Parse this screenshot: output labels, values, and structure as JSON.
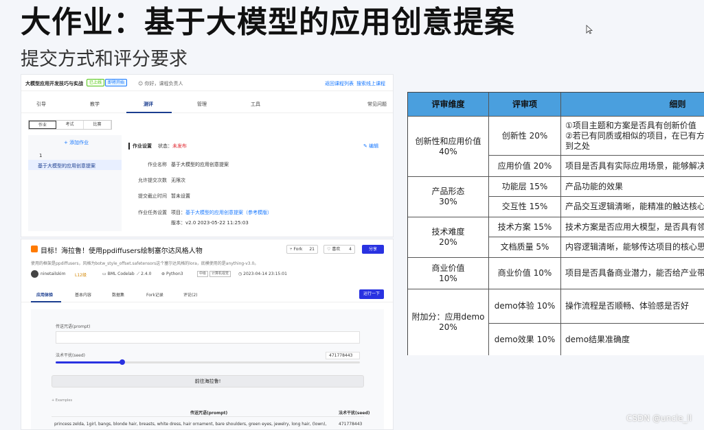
{
  "slide": {
    "title": "大作业：基于大模型的应用创意提案",
    "subtitle": "提交方式和评分要求",
    "watermark": "CSDN @uncle_ll"
  },
  "shot1": {
    "course": "大模型应用开发技巧与实战",
    "badge_online": "已上线",
    "badge_open": "即将开始",
    "hello": "你好，课程负责人",
    "link_list": "返回课程列表",
    "link_online": "搜索线上课程",
    "nav": [
      "引导",
      "教学",
      "测评",
      "管理",
      "工具"
    ],
    "nav_active": "测评",
    "faq": "常见问题",
    "subtabs": [
      "作业",
      "考试",
      "比赛"
    ],
    "add_homework": "+ 添加作业",
    "item_number": "1",
    "item_name": "基于大模型的应用创意提案",
    "section_title": "作业设置",
    "status_label": "状态：",
    "status_value": "未发布",
    "edit": "编辑",
    "fields": [
      {
        "label": "作业名称",
        "value": "基于大模型的应用创意提案"
      },
      {
        "label": "允许提交次数",
        "value": "无限次"
      },
      {
        "label": "提交截止时间",
        "value": "暂未设置"
      }
    ],
    "task_label": "作业任务设置",
    "task_prefix": "项目：",
    "task_link": "基于大模型的应用创意提案（参考模版）",
    "version": "版本：v2.0 2023-05-22 11:25:03"
  },
  "shot2": {
    "title": "目标！海拉鲁！使用ppdiffusers绘制塞尔达风格人物",
    "fork_label": "Fork",
    "fork_count": "21",
    "like_label": "喜欢",
    "like_count": "4",
    "share": "分享",
    "desc": "使用的框架是ppdiffusers，风格为botw_style_offset.safetensors这个塞尔达风格的lora，底模使用的是anything-v3.0。",
    "author": "ninetailskim",
    "level": "L12级",
    "env": "BML Codelab",
    "version": "2.4.0",
    "lang": "Python3",
    "tag1": "中级",
    "tag2": "计算机视觉",
    "date": "2023-04-14 23:15:01",
    "tabs": [
      "应用体验",
      "基本内容",
      "数据集",
      "Fork记录",
      "评论(2)"
    ],
    "run": "运行一下",
    "prompt_label": "传送咒语(prompt)",
    "seed_label": "法术干扰(seed)",
    "seed_value": "471778443",
    "seed_fraction": 0.22,
    "go_button": "前往海拉鲁!",
    "examples": "+ Examples",
    "col_prompt": "传送咒语(prompt)",
    "col_seed": "法术干扰(seed)",
    "example_prompt": "princess zelda, 1girl, bangs, blonde hair, breasts, white dress, hair ornament, bare shoulders, green eyes, jewelry, long hair, (lown),",
    "example_seed": "471778443"
  },
  "table": {
    "headers": [
      "评审维度",
      "评审项",
      "细则"
    ],
    "rows": [
      {
        "dim": "创新性和应用价值\n40%",
        "items": [
          {
            "item": "创新性 20%",
            "detail": "①项目主题和方案是否具有创新价值\n②若已有同质或相似的项目，在已有方案\n到之处"
          },
          {
            "item": "应用价值 20%",
            "detail": "项目是否具有实际应用场景，能够解决实"
          }
        ]
      },
      {
        "dim": "产品形态\n30%",
        "items": [
          {
            "item": "功能层 15%",
            "detail": "产品功能的效果"
          },
          {
            "item": "交互性 15%",
            "detail": "产品交互逻辑清晰，能精准的触达核心功"
          }
        ]
      },
      {
        "dim": "技术难度\n20%",
        "items": [
          {
            "item": "技术方案 15%",
            "detail": "技术方案是否应用大模型，是否具有领先"
          },
          {
            "item": "文档质量 5%",
            "detail": "内容逻辑清晰，能够传达项目的核心思想"
          }
        ]
      },
      {
        "dim": "商业价值\n10%",
        "items": [
          {
            "item": "商业价值 10%",
            "detail": "项目是否具备商业潜力，能否给产业带来"
          }
        ]
      },
      {
        "dim": "附加分：应用demo\n20%",
        "items": [
          {
            "item": "demo体验 10%",
            "detail": "操作流程是否顺畅、体验感是否好"
          },
          {
            "item": "demo效果 10%",
            "detail": "demo结果准确度"
          }
        ]
      }
    ]
  }
}
